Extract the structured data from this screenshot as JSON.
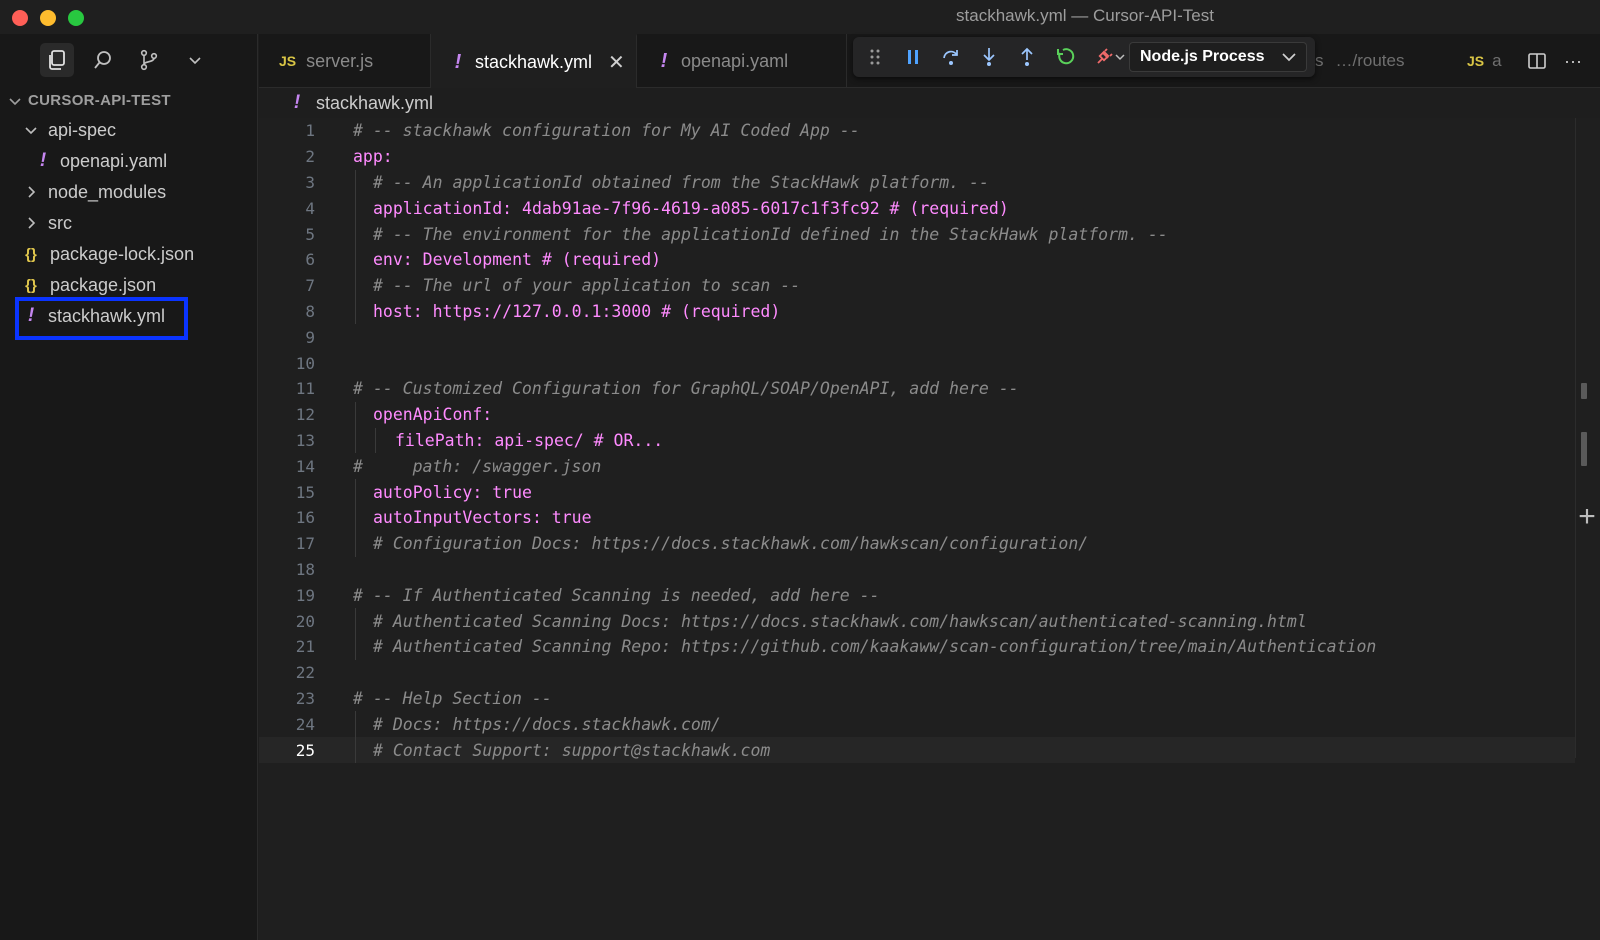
{
  "window": {
    "title": "stackhawk.yml — Cursor-API-Test"
  },
  "explorer": {
    "root": "CURSOR-API-TEST",
    "items": [
      {
        "label": "api-spec",
        "icon": "chevron-down-icon"
      },
      {
        "label": "openapi.yaml",
        "icon": "yaml-icon"
      },
      {
        "label": "node_modules",
        "icon": "chevron-right-icon"
      },
      {
        "label": "src",
        "icon": "chevron-right-icon"
      },
      {
        "label": "package-lock.json",
        "icon": "json-icon"
      },
      {
        "label": "package.json",
        "icon": "json-icon"
      },
      {
        "label": "stackhawk.yml",
        "icon": "yaml-icon"
      }
    ]
  },
  "tabs": [
    {
      "label": "server.js",
      "badge": "JS"
    },
    {
      "label": "stackhawk.yml",
      "badge": "!"
    },
    {
      "label": "openapi.yaml",
      "badge": "!"
    }
  ],
  "debug": {
    "process": "Node.js Process"
  },
  "right_tabs": {
    "partial_1": "s",
    "partial_2": "…/routes",
    "partial_3_badge": "JS",
    "partial_3": "a"
  },
  "breadcrumb": {
    "file": "stackhawk.yml"
  },
  "editor": {
    "current_line": "25",
    "lines": [
      {
        "n": "1",
        "t": "# -- stackhawk configuration for My AI Coded App --"
      },
      {
        "n": "2",
        "t": "app:"
      },
      {
        "n": "3",
        "t": "# -- An applicationId obtained from the StackHawk platform. --"
      },
      {
        "n": "4",
        "t": "applicationId: 4dab91ae-7f96-4619-a085-6017c1f3fc92 # (required)"
      },
      {
        "n": "5",
        "t": "# -- The environment for the applicationId defined in the StackHawk platform. --"
      },
      {
        "n": "6",
        "t": "env: Development # (required)"
      },
      {
        "n": "7",
        "t": "# -- The url of your application to scan --"
      },
      {
        "n": "8",
        "t": "host: https://127.0.0.1:3000 # (required)"
      },
      {
        "n": "9",
        "t": ""
      },
      {
        "n": "10",
        "t": ""
      },
      {
        "n": "11",
        "t": "# -- Customized Configuration for GraphQL/SOAP/OpenAPI, add here --"
      },
      {
        "n": "12",
        "t": "openApiConf:"
      },
      {
        "n": "13",
        "t": "filePath: api-spec/ # OR..."
      },
      {
        "n": "14",
        "t": "#     path: /swagger.json"
      },
      {
        "n": "15",
        "t": "autoPolicy: true"
      },
      {
        "n": "16",
        "t": "autoInputVectors: true"
      },
      {
        "n": "17",
        "t": "# Configuration Docs: https://docs.stackhawk.com/hawkscan/configuration/"
      },
      {
        "n": "18",
        "t": ""
      },
      {
        "n": "19",
        "t": "# -- If Authenticated Scanning is needed, add here --"
      },
      {
        "n": "20",
        "t": "# Authenticated Scanning Docs: https://docs.stackhawk.com/hawkscan/authenticated-scanning.html"
      },
      {
        "n": "21",
        "t": "# Authenticated Scanning Repo: https://github.com/kaakaww/scan-configuration/tree/main/Authentication"
      },
      {
        "n": "22",
        "t": ""
      },
      {
        "n": "23",
        "t": "# -- Help Section --"
      },
      {
        "n": "24",
        "t": "# Docs: https://docs.stackhawk.com/"
      },
      {
        "n": "25",
        "t": "# Contact Support: support@stackhawk.com"
      }
    ]
  }
}
